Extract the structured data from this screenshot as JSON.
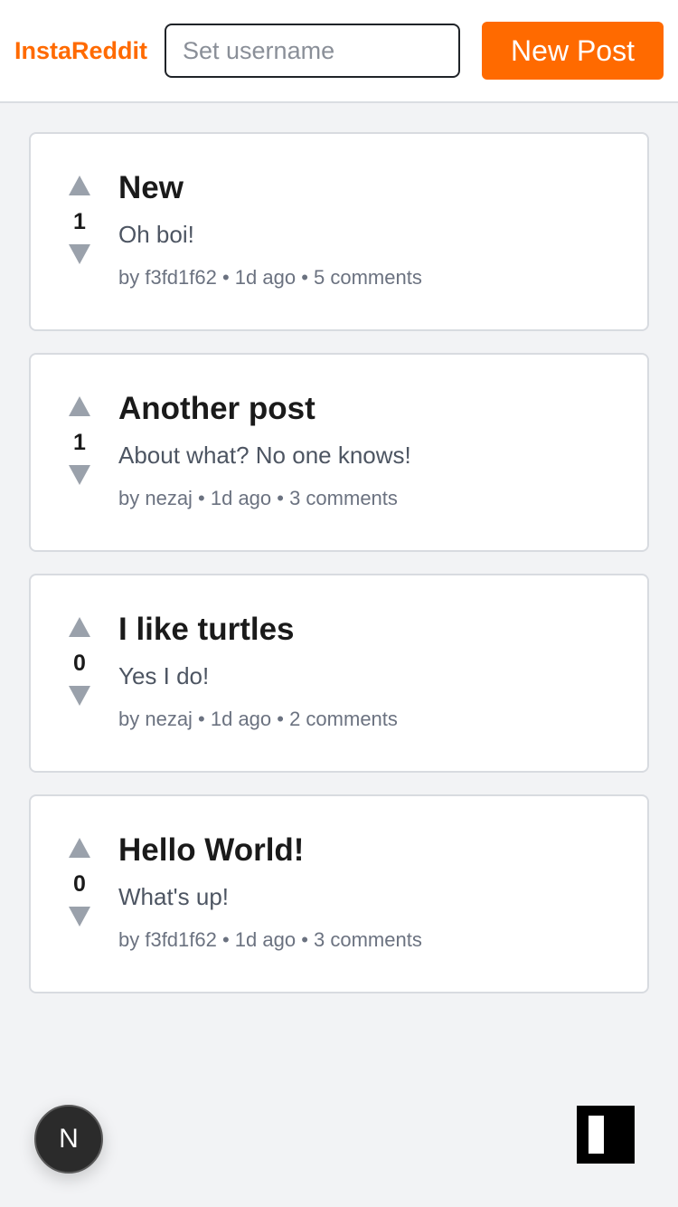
{
  "header": {
    "brand": "InstaReddit",
    "username_placeholder": "Set username",
    "new_post_label": "New Post"
  },
  "posts": [
    {
      "score": "1",
      "title": "New",
      "body": "Oh boi!",
      "meta": "by f3fd1f62 • 1d ago • 5 comments"
    },
    {
      "score": "1",
      "title": "Another post",
      "body": "About what? No one knows!",
      "meta": "by nezaj • 1d ago • 3 comments"
    },
    {
      "score": "0",
      "title": "I like turtles",
      "body": "Yes I do!",
      "meta": "by nezaj • 1d ago • 2 comments"
    },
    {
      "score": "0",
      "title": "Hello World!",
      "body": "What's up!",
      "meta": "by f3fd1f62 • 1d ago • 3 comments"
    }
  ],
  "dev_badge": {
    "letter": "N"
  },
  "icons": {
    "upvote": "triangle-up-icon",
    "downvote": "triangle-down-icon",
    "corner_widget": "panel-icon"
  },
  "colors": {
    "brand": "#ff6a00",
    "button_bg": "#ff6a00",
    "vote_arrow": "#9aa1ab"
  }
}
